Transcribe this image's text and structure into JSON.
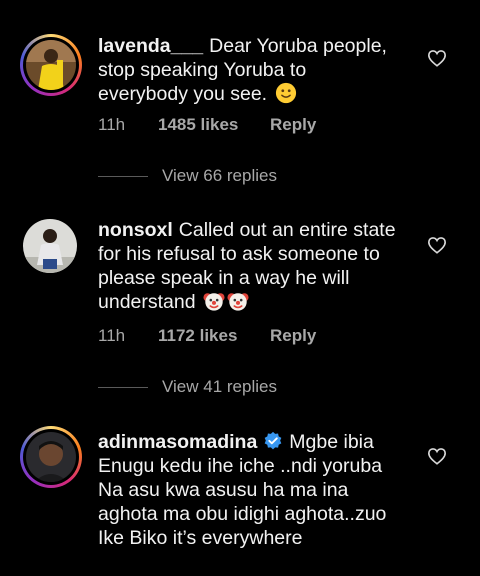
{
  "comments": [
    {
      "username": "lavenda___",
      "text": "Dear Yoruba people, stop speaking Yoruba to everybody you see.",
      "emoji_icon": "slightly-smiling-face-emoji",
      "time": "11h",
      "likes": "1485 likes",
      "reply_label": "Reply",
      "view_replies": "View 66 replies"
    },
    {
      "username": "nonsoxl",
      "text": "Called out an entire state for his refusal to ask someone to please speak in a way he will understand",
      "emoji_icon": "clown-face-emoji",
      "time": "11h",
      "likes": "1172 likes",
      "reply_label": "Reply",
      "view_replies": "View 41 replies"
    },
    {
      "username": "adinmasomadina",
      "verified": true,
      "text": "Mgbe ibia Enugu kedu ihe iche ..ndi yoruba Na asu kwa asusu ha ma ina aghota ma obu idighi aghota..zuo Ike Biko it’s everywhere"
    }
  ],
  "colors": {
    "background": "#000000",
    "text": "#f2f2f2",
    "muted": "#a8a8a8",
    "verified_blue": "#3897f0"
  }
}
